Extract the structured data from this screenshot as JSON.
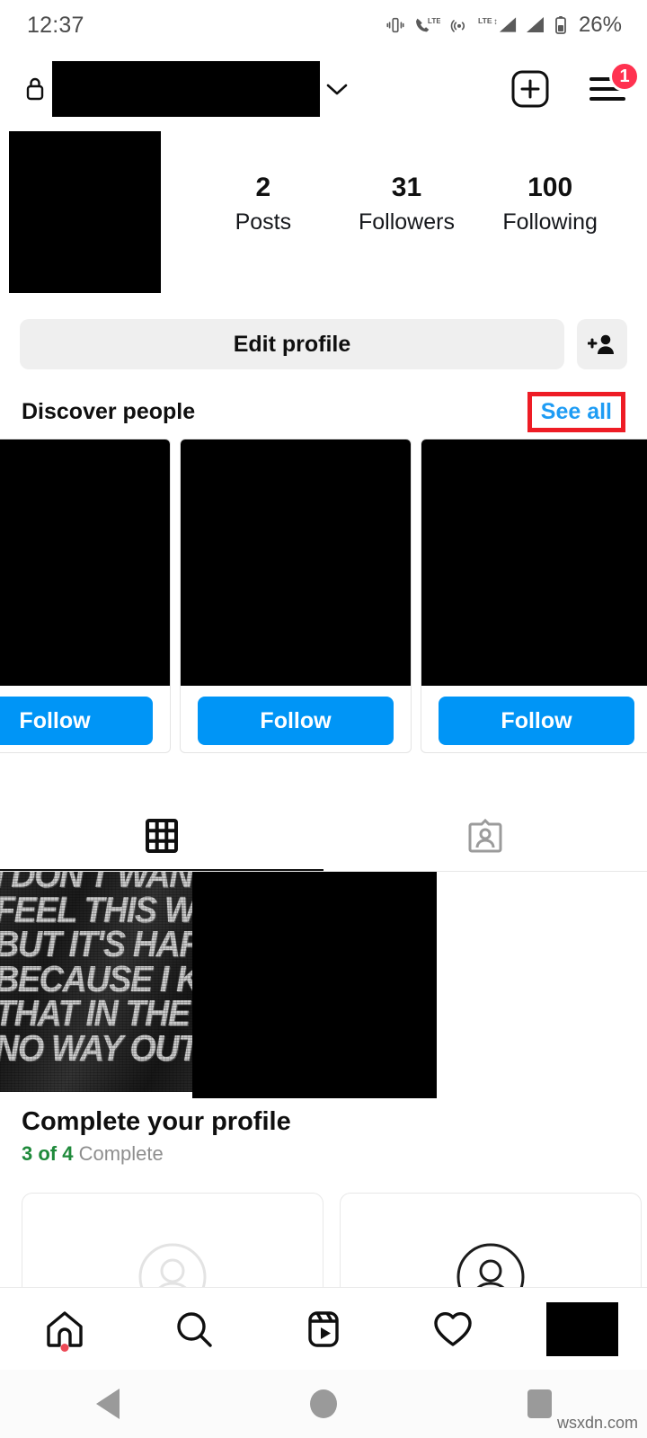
{
  "status_bar": {
    "time": "12:37",
    "battery_percent": "26%",
    "icons": [
      "vibrate-icon",
      "volte-icon",
      "hotspot-icon",
      "lte-plus-icon",
      "signal-bars-icon",
      "signal-bars-2-icon",
      "battery-icon"
    ]
  },
  "app_header": {
    "lock_icon": "lock-icon",
    "username": "",
    "username_redacted": true,
    "chevron_icon": "chevron-down-icon",
    "create_icon": "plus-square-icon",
    "menu_icon": "hamburger-menu-icon",
    "menu_badge": "1"
  },
  "profile": {
    "avatar_redacted": true,
    "stats": [
      {
        "value": "2",
        "label": "Posts"
      },
      {
        "value": "31",
        "label": "Followers"
      },
      {
        "value": "100",
        "label": "Following"
      }
    ]
  },
  "actions": {
    "edit_profile_label": "Edit profile",
    "add_person_icon": "add-person-icon"
  },
  "discover": {
    "title": "Discover people",
    "see_all_label": "See all",
    "see_all_highlight_color": "#ee1c25",
    "cards": [
      {
        "follow_label": "Follow",
        "redacted": true
      },
      {
        "follow_label": "Follow",
        "redacted": true
      },
      {
        "follow_label": "Follow",
        "redacted": true
      }
    ]
  },
  "tabs": [
    {
      "name": "grid-tab",
      "icon": "grid-icon",
      "active": true
    },
    {
      "name": "tagged-tab",
      "icon": "tagged-person-card-icon",
      "active": false
    }
  ],
  "posts": [
    {
      "type": "lyric-poster",
      "text_lines": [
        "I DON'T WANT TO",
        "FEEL THIS WAY",
        "BUT IT'S HARD",
        "BECAUSE I KNOW",
        "THAT IN THE END THERE",
        "NO WAY OUT"
      ]
    },
    {
      "type": "redacted"
    },
    {
      "type": "empty"
    }
  ],
  "complete_profile": {
    "title": "Complete your profile",
    "progress_done": "3 of 4",
    "progress_rest": "Complete",
    "progress_color": "#1f8a3b",
    "cards": [
      {
        "icon": "avatar-placeholder-icon",
        "tone": "light"
      },
      {
        "icon": "avatar-placeholder-icon",
        "tone": "dark"
      }
    ]
  },
  "bottom_nav": [
    {
      "name": "home-tab",
      "icon": "home-icon",
      "has_dot": true
    },
    {
      "name": "search-tab",
      "icon": "search-icon",
      "has_dot": false
    },
    {
      "name": "reels-tab",
      "icon": "reels-icon",
      "has_dot": false
    },
    {
      "name": "activity-tab",
      "icon": "heart-icon",
      "has_dot": false
    },
    {
      "name": "profile-tab",
      "icon": "profile-avatar-icon",
      "has_dot": false,
      "redacted": true
    }
  ],
  "android_nav": {
    "back": "back-triangle-icon",
    "home": "home-circle-icon",
    "recents": "recents-square-icon"
  },
  "watermark": "wsxdn.com",
  "colors": {
    "accent_blue": "#0095f6",
    "link_blue": "#1e9cf4",
    "badge_red": "#ff3250",
    "annotation_red": "#ee1c25",
    "green": "#1f8a3b"
  }
}
